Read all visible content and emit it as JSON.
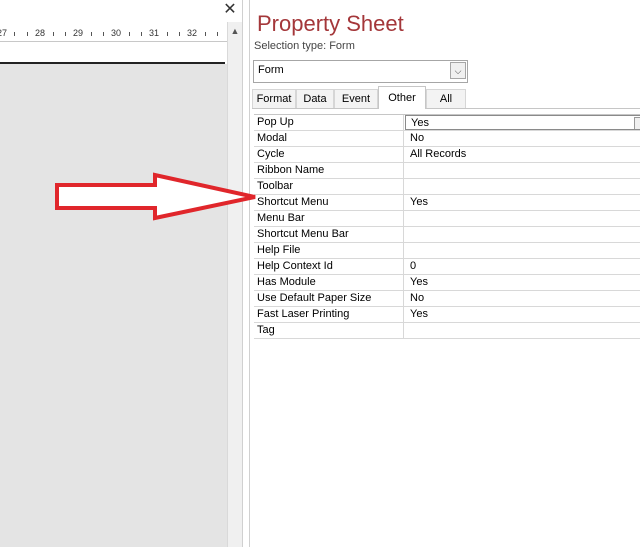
{
  "designer": {
    "close_glyph": "✕",
    "scroll_up_glyph": "▲",
    "ruler_labels": [
      "27",
      "28",
      "29",
      "30",
      "31",
      "32"
    ]
  },
  "property_sheet": {
    "title": "Property Sheet",
    "selection_type_label": "Selection type:  Form",
    "object_combo": {
      "value": "Form",
      "dropdown_glyph": "⌵"
    },
    "tabs": [
      {
        "label": "Format",
        "active": false
      },
      {
        "label": "Data",
        "active": false
      },
      {
        "label": "Event",
        "active": false
      },
      {
        "label": "Other",
        "active": true
      },
      {
        "label": "All",
        "active": false
      }
    ],
    "properties": [
      {
        "name": "Pop Up",
        "value": "Yes"
      },
      {
        "name": "Modal",
        "value": "No"
      },
      {
        "name": "Cycle",
        "value": "All Records"
      },
      {
        "name": "Ribbon Name",
        "value": ""
      },
      {
        "name": "Toolbar",
        "value": ""
      },
      {
        "name": "Shortcut Menu",
        "value": "Yes"
      },
      {
        "name": "Menu Bar",
        "value": ""
      },
      {
        "name": "Shortcut Menu Bar",
        "value": ""
      },
      {
        "name": "Help File",
        "value": ""
      },
      {
        "name": "Help Context Id",
        "value": "0"
      },
      {
        "name": "Has Module",
        "value": "Yes"
      },
      {
        "name": "Use Default Paper Size",
        "value": "No"
      },
      {
        "name": "Fast Laser Printing",
        "value": "Yes"
      },
      {
        "name": "Tag",
        "value": ""
      }
    ]
  },
  "annotation": {
    "arrow_color": "#e0262b",
    "points_to": "Shortcut Menu"
  },
  "colors": {
    "title": "#a4373a",
    "designer_background": "#e4e4e4"
  }
}
